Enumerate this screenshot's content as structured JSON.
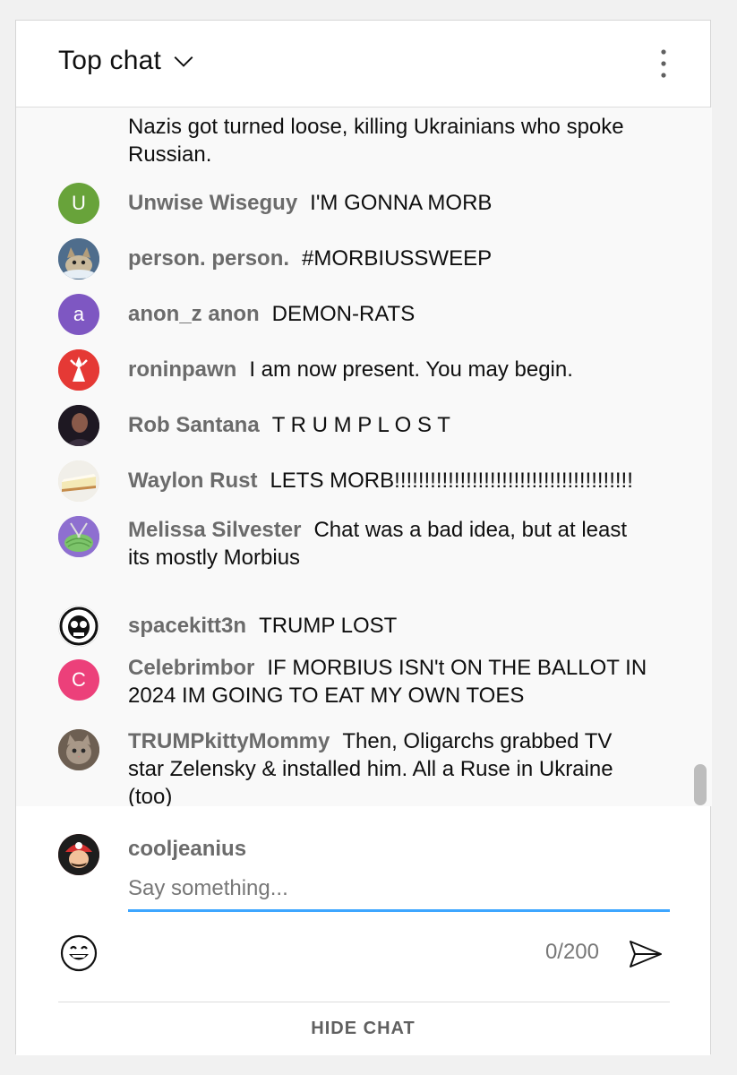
{
  "header": {
    "title": "Top chat",
    "icons": {
      "dropdown": "chevron-down-icon",
      "menu": "more-vert-icon"
    }
  },
  "messages": [
    {
      "author": "",
      "text": "Nazis got turned loose, killing Ukrainians who spoke Russian.",
      "avatar_letter": "",
      "avatar_color": ""
    },
    {
      "author": "Unwise Wiseguy",
      "text": "I'M GONNA MORB",
      "avatar_letter": "U",
      "avatar_color": "#68a33a"
    },
    {
      "author": "person. person.",
      "text": "#MORBIUSSWEEP",
      "avatar_letter": "",
      "avatar_color": "#5b7fa0"
    },
    {
      "author": "anon_z anon",
      "text": "DEMON-RATS",
      "avatar_letter": "a",
      "avatar_color": "#7e57c2"
    },
    {
      "author": "roninpawn",
      "text": "I am now present. You may begin.",
      "avatar_letter": "",
      "avatar_color": "#e53935"
    },
    {
      "author": "Rob Santana",
      "text": "T R U M P L O S T",
      "avatar_letter": "",
      "avatar_color": "#2b2230"
    },
    {
      "author": "Waylon Rust",
      "text": "LETS MORB!!!!!!!!!!!!!!!!!!!!!!!!!!!!!!!!!!!!!!!!",
      "avatar_letter": "",
      "avatar_color": "#e8dcc0"
    },
    {
      "author": "Melissa Silvester",
      "text": "Chat was a bad idea, but at least its mostly Morbius",
      "avatar_letter": "",
      "avatar_color": "#8a6fc8"
    },
    {
      "author": "spacekitt3n",
      "text": "TRUMP LOST",
      "avatar_letter": "",
      "avatar_color": "#111111"
    },
    {
      "author": "Celebrimbor",
      "text": "IF MORBIUS ISN't ON THE BALLOT IN 2024 IM GOING TO EAT MY OWN TOES",
      "avatar_letter": "C",
      "avatar_color": "#ec407a"
    },
    {
      "author": "TRUMPkittyMommy",
      "text": "Then, Oligarchs grabbed TV star Zelensky & installed him. All a Ruse in Ukraine (too)",
      "avatar_letter": "",
      "avatar_color": "#8d7b68"
    }
  ],
  "composer": {
    "username": "cooljeanius",
    "placeholder": "Say something...",
    "value": "",
    "counter": "0/200",
    "icons": {
      "emoji": "smiley-icon",
      "send": "send-icon"
    }
  },
  "footer": {
    "hide_chat": "HIDE CHAT"
  },
  "colors": {
    "accent": "#3ea6ff",
    "author": "#6b6b6b"
  }
}
